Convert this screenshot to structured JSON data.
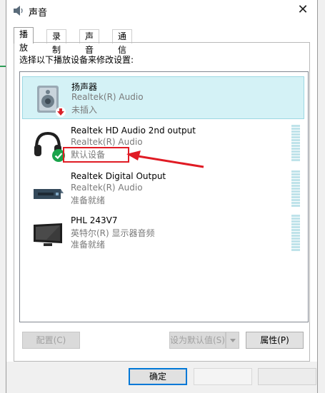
{
  "window": {
    "title": "声音",
    "close_glyph": "✕"
  },
  "tabs": [
    {
      "label": "播放",
      "active": true
    },
    {
      "label": "录制",
      "active": false
    },
    {
      "label": "声音",
      "active": false
    },
    {
      "label": "通信",
      "active": false
    }
  ],
  "instruction": "选择以下播放设备来修改设置:",
  "devices": [
    {
      "name": "扬声器",
      "driver": "Realtek(R) Audio",
      "status": "未插入",
      "icon": "speaker-icon",
      "badge": "unplugged-badge-icon",
      "selected": true
    },
    {
      "name": "Realtek HD Audio 2nd output",
      "driver": "Realtek(R) Audio",
      "status": "默认设备",
      "icon": "headphones-icon",
      "badge": "default-check-icon",
      "selected": false
    },
    {
      "name": "Realtek Digital Output",
      "driver": "Realtek(R) Audio",
      "status": "准备就绪",
      "icon": "digital-output-icon",
      "selected": false
    },
    {
      "name": "PHL 243V7",
      "driver": "英特尔(R) 显示器音频",
      "status": "准备就绪",
      "icon": "monitor-icon",
      "selected": false
    }
  ],
  "buttons": {
    "configure": "配置(C)",
    "set_default": "设为默认值(S)",
    "properties": "属性(P)",
    "ok": "确定"
  },
  "colors": {
    "selection_bg": "#d4f2f6",
    "highlight": "#e01b24",
    "accent": "#0078d7"
  }
}
